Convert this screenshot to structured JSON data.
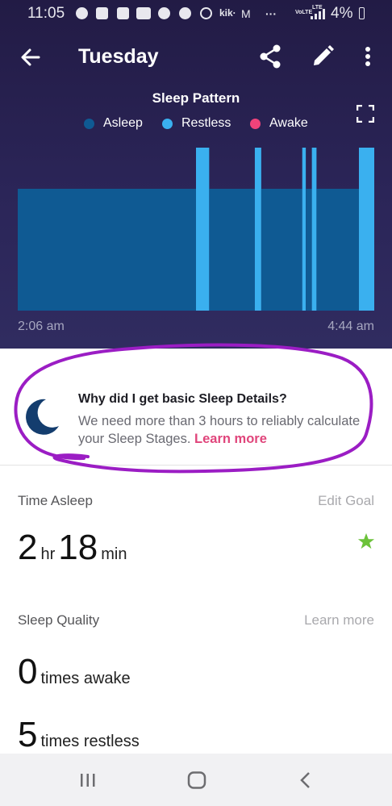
{
  "status_bar": {
    "time": "11:05",
    "kik": "kik·",
    "volte": "VoLTE",
    "lte": "LTE",
    "dots": "···",
    "battery": "4%"
  },
  "header": {
    "title": "Tuesday"
  },
  "chart": {
    "title": "Sleep Pattern",
    "legend": [
      {
        "label": "Asleep",
        "color": "#0f5a93"
      },
      {
        "label": "Restless",
        "color": "#3ab0ef"
      },
      {
        "label": "Awake",
        "color": "#f0437a"
      }
    ],
    "start_time": "2:06 am",
    "end_time": "4:44 am"
  },
  "chart_data": {
    "type": "bar",
    "title": "Sleep Pattern",
    "x_range": [
      "2:06 am",
      "4:44 am"
    ],
    "levels": [
      "Asleep",
      "Restless",
      "Awake"
    ],
    "segments": [
      {
        "state": "Asleep",
        "start": 0.0,
        "end": 0.5
      },
      {
        "state": "Restless",
        "start": 0.5,
        "end": 0.537
      },
      {
        "state": "Asleep",
        "start": 0.537,
        "end": 0.665
      },
      {
        "state": "Restless",
        "start": 0.665,
        "end": 0.683
      },
      {
        "state": "Asleep",
        "start": 0.683,
        "end": 0.798
      },
      {
        "state": "Restless",
        "start": 0.798,
        "end": 0.808
      },
      {
        "state": "Asleep",
        "start": 0.808,
        "end": 0.825
      },
      {
        "state": "Restless",
        "start": 0.825,
        "end": 0.838
      },
      {
        "state": "Asleep",
        "start": 0.838,
        "end": 0.957
      },
      {
        "state": "Restless",
        "start": 0.957,
        "end": 1.0
      }
    ],
    "colors": {
      "Asleep": "#0f5a93",
      "Restless": "#3ab0ef",
      "Awake": "#f0437a"
    }
  },
  "info_card": {
    "title": "Why did I get basic Sleep Details?",
    "body": "We need more than 3 hours to reliably calculate your Sleep Stages.",
    "link": "Learn more"
  },
  "time_asleep": {
    "label": "Time Asleep",
    "link": "Edit Goal",
    "hours": "2",
    "hours_unit": "hr",
    "minutes": "18",
    "minutes_unit": "min"
  },
  "sleep_quality": {
    "label": "Sleep Quality",
    "link": "Learn more",
    "awake_count": "0",
    "awake_label": "times awake",
    "restless_count": "5",
    "restless_label": "times restless"
  }
}
